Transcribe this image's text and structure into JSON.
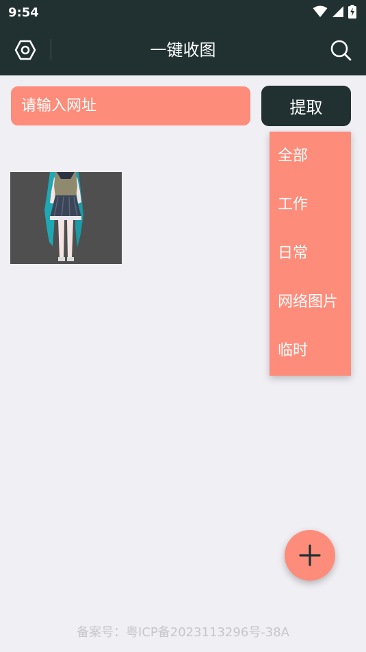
{
  "status_bar": {
    "time": "9:54",
    "icons": [
      "wifi-icon",
      "signal-icon",
      "battery-charging-icon"
    ]
  },
  "toolbar": {
    "title": "一键收图",
    "left_icon": "settings-hexagon-icon",
    "right_icon": "search-icon"
  },
  "url_bar": {
    "placeholder": "请输入网址",
    "value": "",
    "extract_label": "提取"
  },
  "dropdown_menu": {
    "items": [
      {
        "label": "全部"
      },
      {
        "label": "工作"
      },
      {
        "label": "日常"
      },
      {
        "label": "网络图片"
      },
      {
        "label": "临时"
      }
    ]
  },
  "gallery": {
    "images": [
      {
        "icon": "anime-figure-image"
      }
    ]
  },
  "fab": {
    "icon": "plus-icon"
  },
  "footer": {
    "text": "备案号：粤ICP备2023113296号-38A"
  },
  "colors": {
    "header_bg": "#213131",
    "accent": "#fd8c7a",
    "page_bg": "#f0eff4",
    "footer_text": "#c7c6ca"
  }
}
